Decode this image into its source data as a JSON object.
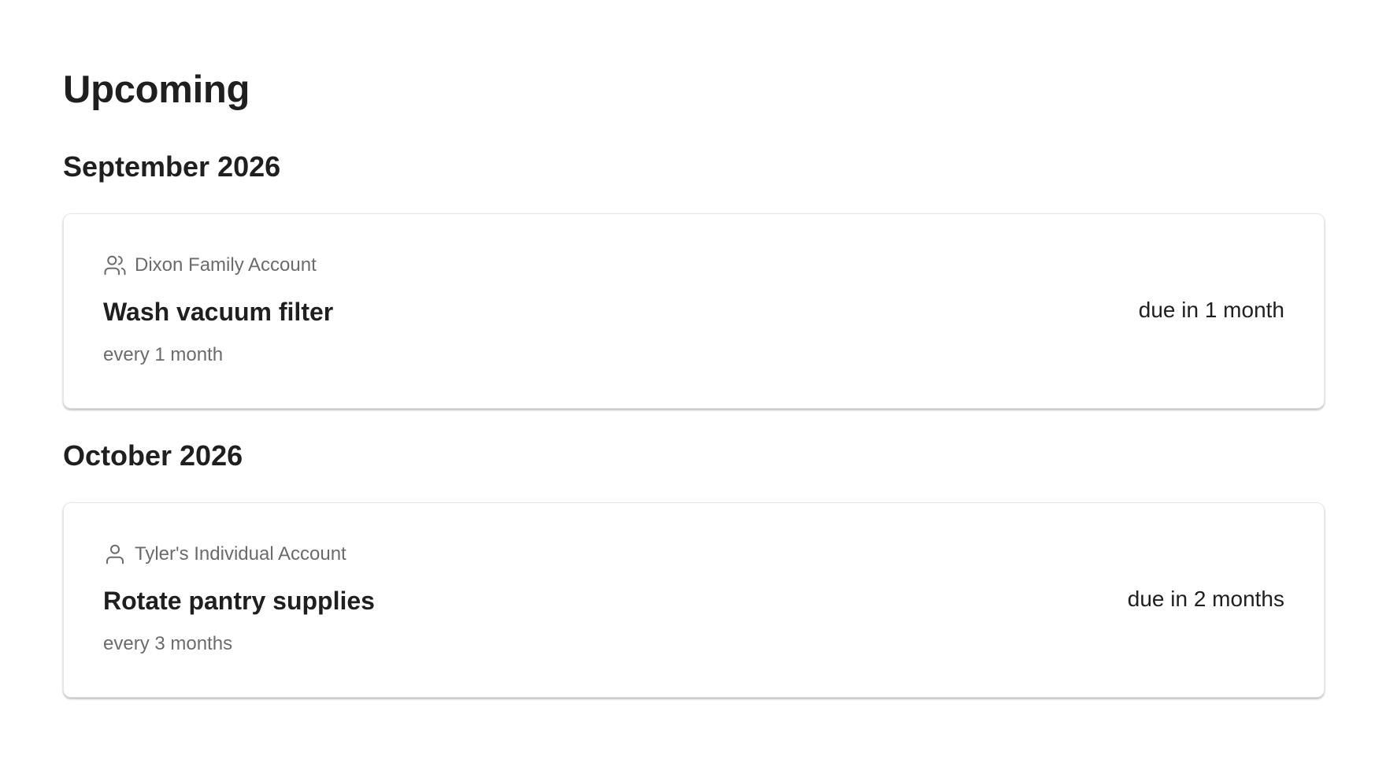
{
  "page": {
    "title": "Upcoming"
  },
  "groups": [
    {
      "month": "September 2026",
      "tasks": [
        {
          "account": "Dixon Family Account",
          "account_icon": "users-icon",
          "title": "Wash vacuum filter",
          "interval": "every 1 month",
          "due": "due in 1 month"
        }
      ]
    },
    {
      "month": "October 2026",
      "tasks": [
        {
          "account": "Tyler's Individual Account",
          "account_icon": "user-icon",
          "title": "Rotate pantry supplies",
          "interval": "every 3 months",
          "due": "due in 2 months"
        }
      ]
    }
  ],
  "colors": {
    "text_primary": "#1f1f1f",
    "text_secondary": "#6b6b6b",
    "card_border": "#e6e6e6",
    "background": "#ffffff"
  }
}
